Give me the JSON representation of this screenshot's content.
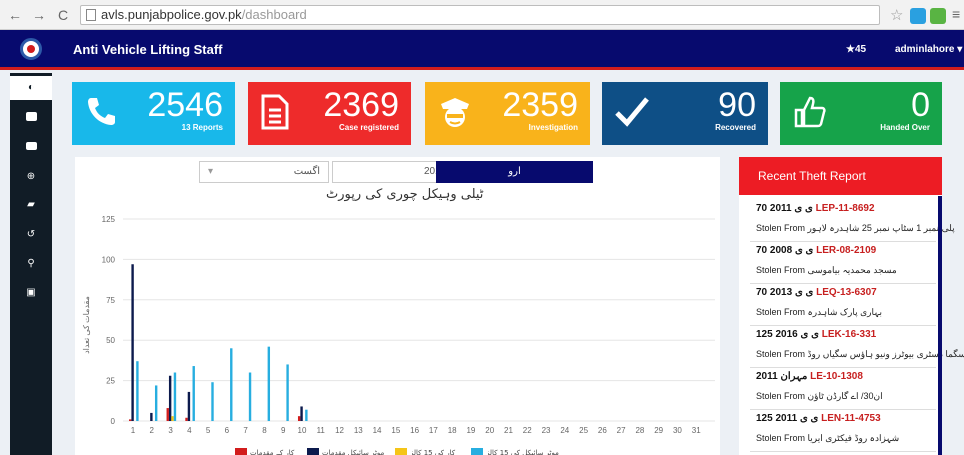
{
  "browser": {
    "url_host": "avls.punjabpolice.gov.pk",
    "url_path": "/dashboard"
  },
  "header": {
    "title": "Anti Vehicle Lifting Staff",
    "stars": "45",
    "user": "adminlahore"
  },
  "cards": [
    {
      "value": "2546",
      "label": "13 Reports",
      "color": "#18b8ea",
      "icon": "phone-icon"
    },
    {
      "value": "2369",
      "label": "Case registered",
      "color": "#ee2b2b",
      "icon": "document-icon"
    },
    {
      "value": "2359",
      "label": "Investigation",
      "color": "#f9b31b",
      "icon": "police-icon"
    },
    {
      "value": "90",
      "label": "Recovered",
      "color": "#0e4f86",
      "icon": "checkmark-icon"
    },
    {
      "value": "0",
      "label": "Handed Over",
      "color": "#16a34a",
      "icon": "thumbs-up-icon"
    }
  ],
  "filters": {
    "month": "اگست",
    "year": "2016",
    "go_label": "ارو"
  },
  "chart_title": "ٹیلی وہیکل چوری کی رپورٹ",
  "chart_data": {
    "type": "bar",
    "title": "ٹیلی وہیکل چوری کی رپورٹ",
    "ylabel": "مقدمات کی تعداد",
    "ylim": [
      0,
      125
    ],
    "yticks": [
      0,
      25,
      50,
      75,
      100,
      125
    ],
    "categories": [
      "1",
      "2",
      "3",
      "4",
      "5",
      "6",
      "7",
      "8",
      "9",
      "10",
      "11",
      "12",
      "13",
      "14",
      "15",
      "16",
      "17",
      "18",
      "19",
      "20",
      "21",
      "22",
      "23",
      "24",
      "25",
      "26",
      "27",
      "28",
      "29",
      "30",
      "31"
    ],
    "series": [
      {
        "name": "کار کے مقدمات",
        "color": "#d21d1d",
        "values": [
          1,
          0,
          8,
          2,
          0,
          0,
          0,
          0,
          0,
          3,
          0,
          0,
          0,
          0,
          0,
          0,
          0,
          0,
          0,
          0,
          0,
          0,
          0,
          0,
          0,
          0,
          0,
          0,
          0,
          0,
          0
        ]
      },
      {
        "name": "موٹر سائیکل مقدمات",
        "color": "#0c1a4d",
        "values": [
          97,
          5,
          28,
          18,
          0,
          0,
          0,
          0,
          0,
          9,
          0,
          0,
          0,
          0,
          0,
          0,
          0,
          0,
          0,
          0,
          0,
          0,
          0,
          0,
          0,
          0,
          0,
          0,
          0,
          0,
          0
        ]
      },
      {
        "name": "کار کی 15 کالز",
        "color": "#f5c518",
        "values": [
          0,
          0,
          3,
          0,
          0,
          0,
          0,
          0,
          0,
          0,
          0,
          0,
          0,
          0,
          0,
          0,
          0,
          0,
          0,
          0,
          0,
          0,
          0,
          0,
          0,
          0,
          0,
          0,
          0,
          0,
          0
        ]
      },
      {
        "name": "موٹر سائیکل کی 15 کالز",
        "color": "#27aee0",
        "values": [
          37,
          22,
          30,
          34,
          24,
          45,
          30,
          46,
          35,
          7,
          0,
          0,
          0,
          0,
          0,
          0,
          0,
          0,
          0,
          0,
          0,
          0,
          0,
          0,
          0,
          0,
          0,
          0,
          0,
          0,
          0
        ]
      }
    ]
  },
  "recent": {
    "title": "Recent Theft Report",
    "items": [
      {
        "year": "70 2011",
        "model": "ی ی",
        "reg": "LEP-11-8692",
        "location": "پلی نمبر 1 سٹاپ نمبر 25 شاہدرہ لاہور",
        "stolen_label": "Stolen From"
      },
      {
        "year": "70 2008",
        "model": "ی ی",
        "reg": "LER-08-2109",
        "location": "مسجد محمدیہ بیاموسی",
        "stolen_label": "Stolen From"
      },
      {
        "year": "70 2013",
        "model": "ی ی",
        "reg": "LEQ-13-6307",
        "location": "بہاری پارک شاہدرہ",
        "stolen_label": "Stolen From"
      },
      {
        "year": "125 2016",
        "model": "ی ی",
        "reg": "LEK-16-331",
        "location": "سگما ڈسٹری بیوٹرز ونیو ہاؤس سگیاں روڈ",
        "stolen_label": "Stolen From"
      },
      {
        "year": "2011",
        "model": "مہران",
        "reg": "LE-10-1308",
        "location": "ان30/ اے گارڈن ٹاؤن",
        "stolen_label": "Stolen From"
      },
      {
        "year": "125 2011",
        "model": "ی ی",
        "reg": "LEN-11-4753",
        "location": "شہزادہ روڈ فیکٹری ایریا",
        "stolen_label": "Stolen From"
      }
    ]
  }
}
